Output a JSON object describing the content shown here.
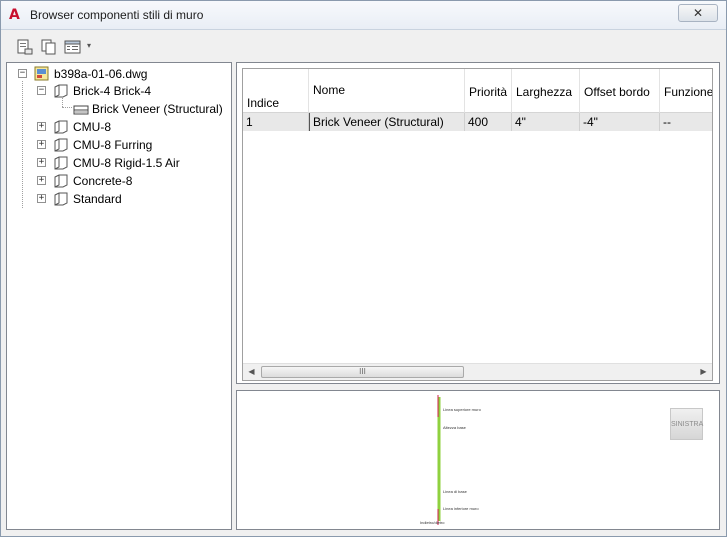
{
  "window": {
    "title": "Browser componenti stili di muro",
    "close_label": "✕"
  },
  "toolbar": {
    "buttons": [
      "import-icon",
      "copy-icon",
      "view-options-icon"
    ],
    "dropdown_arrow": "▾"
  },
  "tree": {
    "root": "b398a-01-06.dwg",
    "items": [
      {
        "label": "Brick-4 Brick-4",
        "expanded": true,
        "children": [
          "Brick Veneer (Structural)"
        ]
      },
      {
        "label": "CMU-8",
        "expanded": false
      },
      {
        "label": "CMU-8 Furring",
        "expanded": false
      },
      {
        "label": "CMU-8 Rigid-1.5 Air",
        "expanded": false
      },
      {
        "label": "Concrete-8",
        "expanded": false
      },
      {
        "label": "Standard",
        "expanded": false
      }
    ]
  },
  "table": {
    "headers": [
      "Indice",
      "Nome",
      "Priorità",
      "Larghezza",
      "Offset bordo",
      "Funzione"
    ],
    "rows": [
      [
        "1",
        "Brick Veneer (Structural)",
        "400",
        "4\"",
        "-4\"",
        "--"
      ]
    ],
    "scroll_grip": "III"
  },
  "preview": {
    "side_button": "SINISTRA",
    "annotations": [
      "Linea superiore muro",
      "Altezza base",
      "Linea di base",
      "Linea inferiore muro",
      "Indietro/dietro"
    ]
  },
  "colors": {
    "accent_red": "#c8102e",
    "preview_green": "#8fd13f",
    "preview_red": "#d11f4d"
  }
}
